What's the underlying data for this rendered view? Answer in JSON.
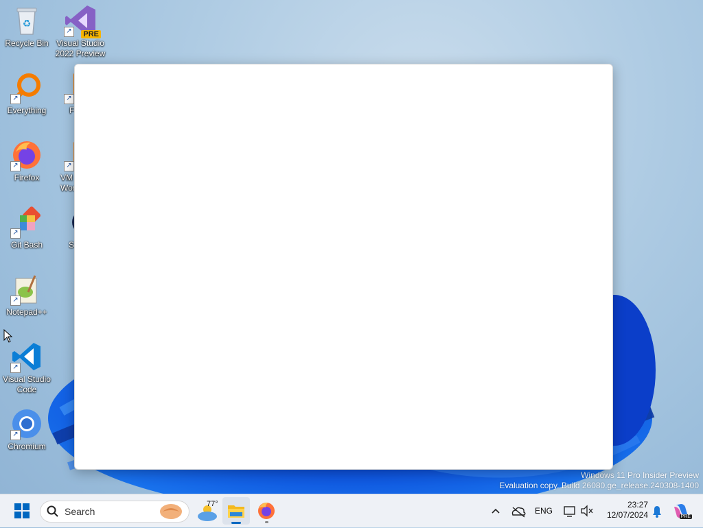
{
  "desktop": {
    "icons": [
      {
        "label": "Recycle Bin"
      },
      {
        "label": "Visual Studio\n2022 Preview",
        "badge": "PRE"
      },
      {
        "label": "Everything"
      },
      {
        "label": "Firefox"
      },
      {
        "label": "Git Bash"
      },
      {
        "label": "Notepad++"
      },
      {
        "label": "Visual Studio\nCode"
      },
      {
        "label": "Chromium"
      },
      {
        "label": "F"
      },
      {
        "label": "VM\nWor"
      },
      {
        "label": "S"
      }
    ]
  },
  "watermark": {
    "line1": "Windows 11 Pro Insider Preview",
    "line2": "Evaluation copy. Build 26080.ge_release.240308-1400"
  },
  "taskbar": {
    "search_placeholder": "Search",
    "weather_temp": "77°",
    "language": "ENG",
    "time": "23:27",
    "date": "12/07/2024",
    "copilot_badge": "PRE"
  },
  "icons": {
    "start": "windows-start-icon",
    "search": "search-icon",
    "weather": "weather-cloud-icon",
    "file_explorer": "file-explorer-icon",
    "firefox": "firefox-icon",
    "chevron": "chevron-up-icon",
    "cloud": "cloud-offline-icon",
    "network": "network-icon",
    "volume": "volume-muted-icon",
    "notifications": "bell-icon",
    "copilot": "copilot-icon"
  },
  "colors": {
    "accent": "#0067c0",
    "taskbar": "#eef1f6",
    "window": "#ffffff"
  }
}
